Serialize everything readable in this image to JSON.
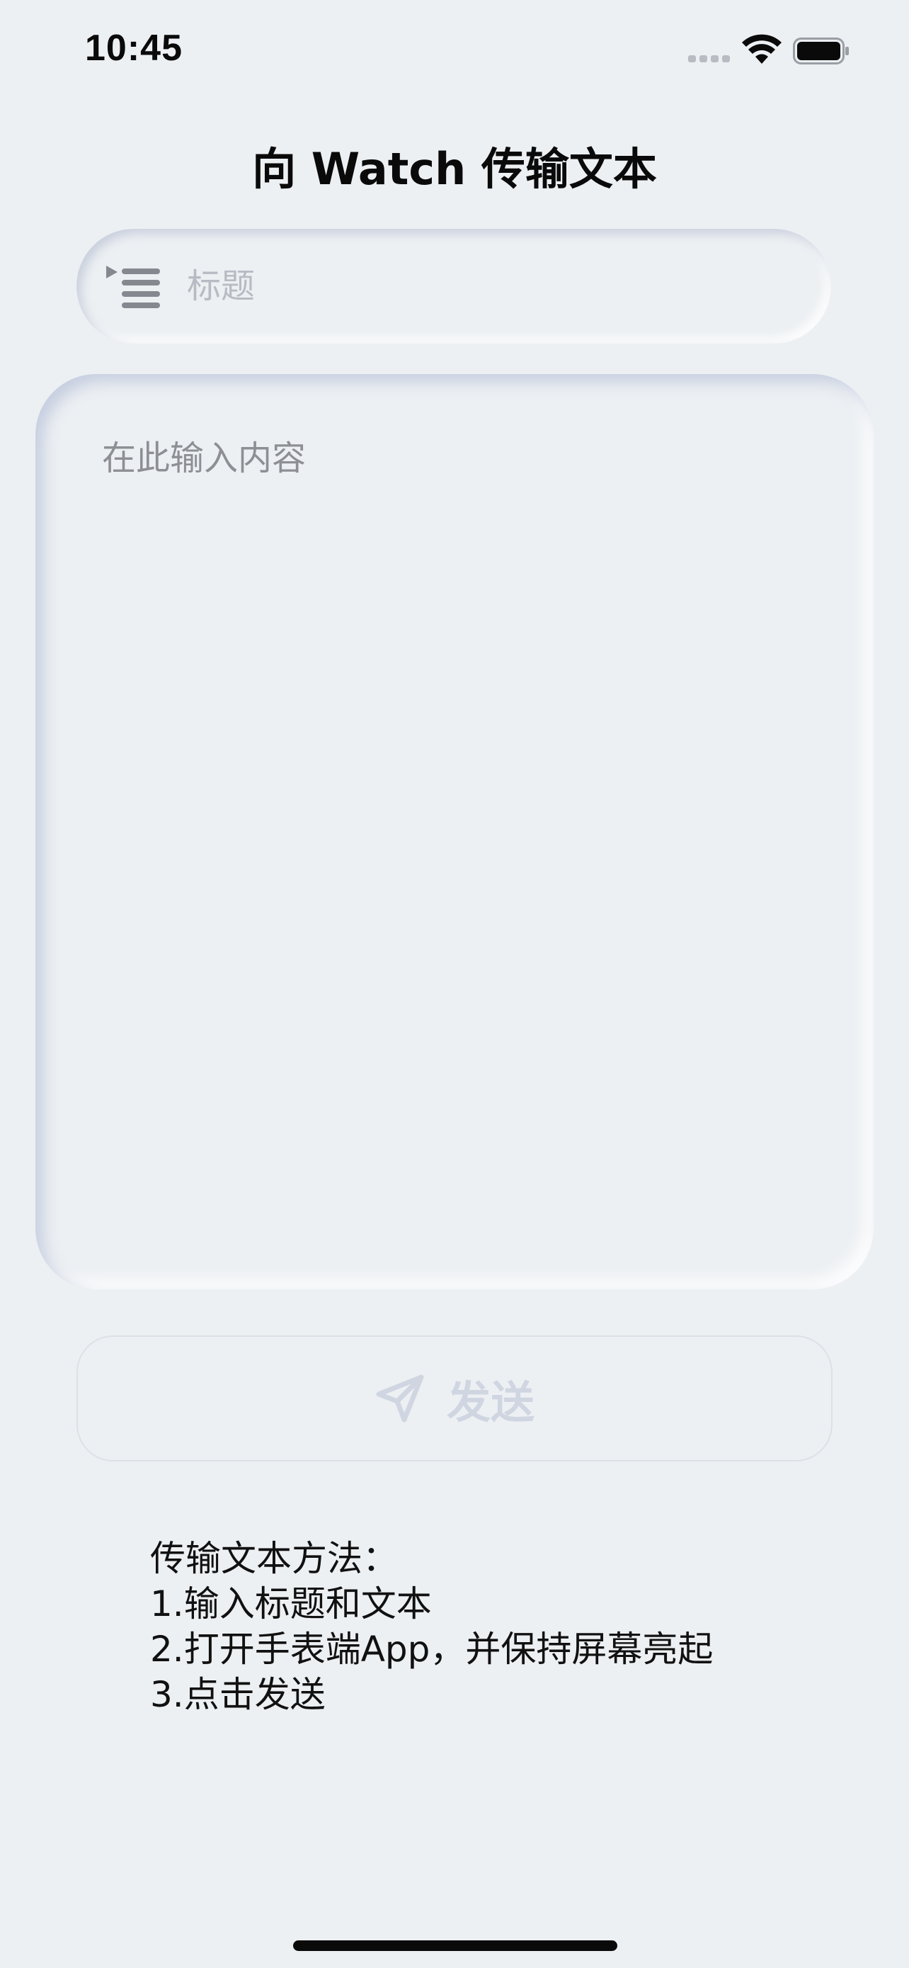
{
  "status_bar": {
    "time": "10:45"
  },
  "page": {
    "title": "向 Watch 传输文本"
  },
  "title_field": {
    "placeholder": "标题",
    "value": "",
    "icon": "list-icon"
  },
  "content_field": {
    "placeholder": "在此输入内容",
    "value": ""
  },
  "send_button": {
    "label": "发送",
    "icon": "paper-plane-icon",
    "enabled": false
  },
  "instructions": {
    "heading": "传输文本方法：",
    "steps": [
      "1.输入标题和文本",
      "2.打开手表端App，并保持屏幕亮起",
      "3.点击发送"
    ]
  },
  "colors": {
    "background": "#edf0f3",
    "placeholder": "#b7bbc3",
    "disabled_accent": "#d0d6e1",
    "text": "#0a0a0a"
  }
}
